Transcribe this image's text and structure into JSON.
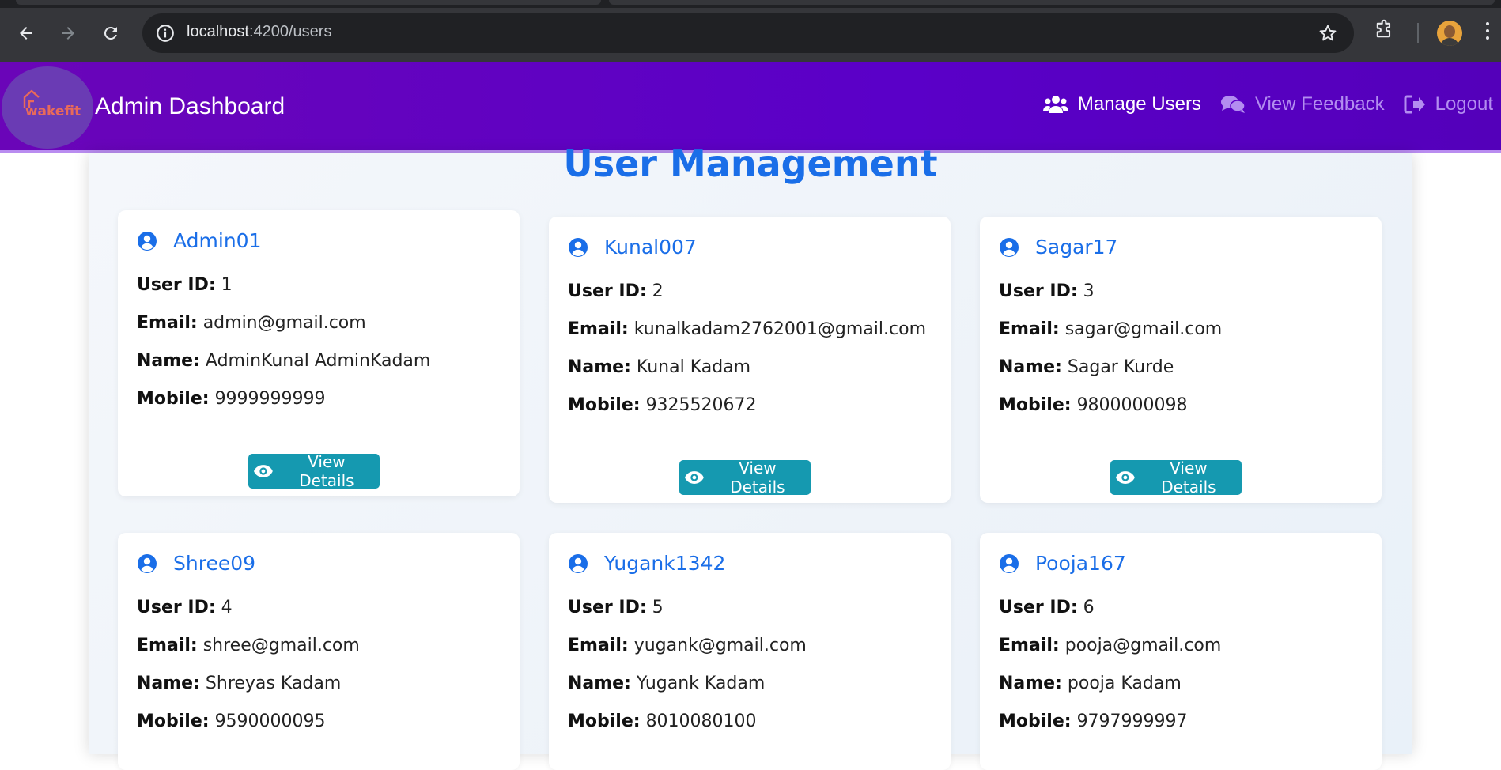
{
  "browser": {
    "url_host": "localhost",
    "url_path": ":4200/users"
  },
  "app": {
    "brand": "Admin Dashboard",
    "logo_text": "wakefit",
    "nav": {
      "manage_users": "Manage Users",
      "view_feedback": "View Feedback",
      "logout": "Logout"
    }
  },
  "page": {
    "title": "User Management",
    "labels": {
      "user_id": "User ID:",
      "email": "Email:",
      "name": "Name:",
      "mobile": "Mobile:"
    },
    "button_label": "View Details"
  },
  "users": [
    {
      "username": "Admin01",
      "id": "1",
      "email": "admin@gmail.com",
      "name": "AdminKunal AdminKadam",
      "mobile": "9999999999"
    },
    {
      "username": "Kunal007",
      "id": "2",
      "email": "kunalkadam2762001@gmail.com",
      "name": "Kunal Kadam",
      "mobile": "9325520672"
    },
    {
      "username": "Sagar17",
      "id": "3",
      "email": "sagar@gmail.com",
      "name": "Sagar Kurde",
      "mobile": "9800000098"
    },
    {
      "username": "Shree09",
      "id": "4",
      "email": "shree@gmail.com",
      "name": "Shreyas Kadam",
      "mobile": "9590000095"
    },
    {
      "username": "Yugank1342",
      "id": "5",
      "email": "yugank@gmail.com",
      "name": "Yugank Kadam",
      "mobile": "8010080100"
    },
    {
      "username": "Pooja167",
      "id": "6",
      "email": "pooja@gmail.com",
      "name": "pooja Kadam",
      "mobile": "9797999997"
    }
  ],
  "colors": {
    "navbar": "#5a00c8",
    "accent_blue": "#1a6ee8",
    "button": "#1599b0"
  }
}
